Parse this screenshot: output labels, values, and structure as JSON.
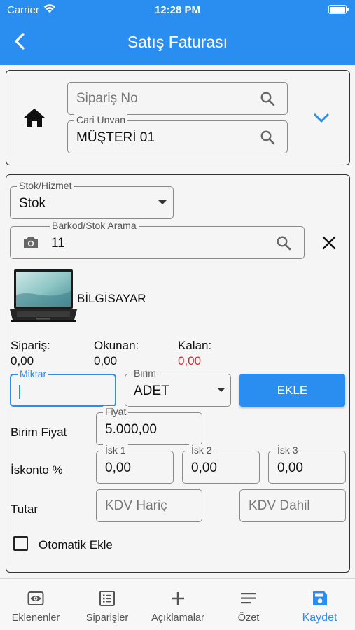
{
  "status_bar": {
    "carrier": "Carrier",
    "time": "12:28 PM"
  },
  "header": {
    "title": "Satış Faturası"
  },
  "document_card": {
    "order_no": {
      "placeholder": "Sipariş No",
      "value": ""
    },
    "customer": {
      "label": "Cari Unvan",
      "value": "MÜŞTERİ 01"
    }
  },
  "item_card": {
    "stock_type": {
      "label": "Stok/Hizmet",
      "value": "Stok"
    },
    "barcode": {
      "label": "Barkod/Stok Arama",
      "value": "11"
    },
    "product": {
      "name": "BİLGİSAYAR"
    },
    "stats": {
      "ordered_label": "Sipariş:",
      "ordered_value": "0,00",
      "read_label": "Okunan:",
      "read_value": "0,00",
      "remaining_label": "Kalan:",
      "remaining_value": "0,00"
    },
    "quantity": {
      "label": "Miktar",
      "value": ""
    },
    "unit": {
      "label": "Birim",
      "value": "ADET"
    },
    "add_button": "EKLE",
    "unit_price": {
      "row_label": "Birim Fiyat",
      "field_label": "Fiyat",
      "value": "5.000,00"
    },
    "discount": {
      "row_label": "İskonto %",
      "fields": [
        {
          "label": "İsk 1",
          "value": "0,00"
        },
        {
          "label": "İsk 2",
          "value": "0,00"
        },
        {
          "label": "İsk 3",
          "value": "0,00"
        }
      ]
    },
    "total": {
      "row_label": "Tutar",
      "excl_vat_placeholder": "KDV Hariç",
      "incl_vat_placeholder": "KDV Dahil"
    },
    "auto_add": {
      "label": "Otomatik Ekle",
      "checked": false
    }
  },
  "tabs": [
    {
      "label": "Eklenenler",
      "icon": "eye-icon"
    },
    {
      "label": "Siparişler",
      "icon": "list-icon"
    },
    {
      "label": "Açıklamalar",
      "icon": "plus-icon"
    },
    {
      "label": "Özet",
      "icon": "menu-icon"
    },
    {
      "label": "Kaydet",
      "icon": "save-icon",
      "active": true
    }
  ],
  "colors": {
    "primary": "#2a8df0",
    "remaining_red": "#d9262c",
    "border": "#8a8a8a"
  }
}
